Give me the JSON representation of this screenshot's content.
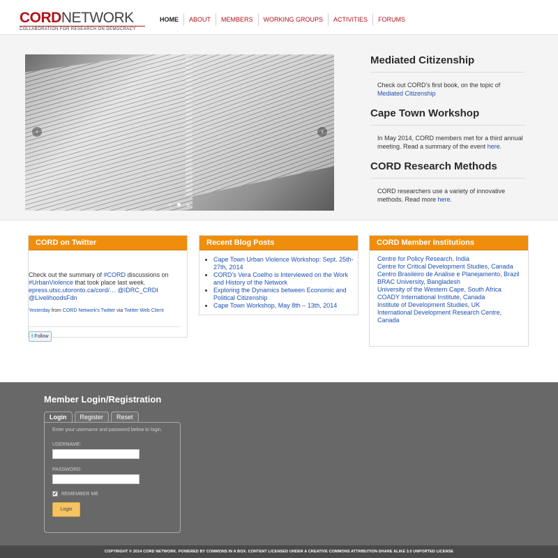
{
  "header": {
    "logo_brand_cord": "CORD",
    "logo_brand_network": "NETWORK",
    "logo_tagline": "COLLABORATION FOR RESEARCH ON DEMOCRACY",
    "nav": [
      "HOME",
      "ABOUT",
      "MEMBERS",
      "WORKING GROUPS",
      "ACTIVITIES",
      "FORUMS"
    ]
  },
  "hero": {
    "prev_arrow": "‹",
    "next_arrow": "›",
    "slide_count": 3,
    "active_slide": 2,
    "features": [
      {
        "title": "Mediated Citizenship",
        "text": "Check out CORD's first book, on the topic of ",
        "link": "Mediated Citizenship"
      },
      {
        "title": "Cape Town Workshop",
        "text": "In May 2014, CORD members met for a third annual meeting. Read a summary of the event ",
        "link": "here."
      },
      {
        "title": "CORD Research Methods",
        "text": "CORD researchers use a variety of innovative methods. Read more ",
        "link": "here."
      }
    ]
  },
  "twitter": {
    "title": "CORD on Twitter",
    "tweet_pre": "Check out the summary of ",
    "tweet_hash1": "#CORD",
    "tweet_mid": " discussions on ",
    "tweet_hash2": "#UrbanViolence",
    "tweet_mid2": " that took place last week. ",
    "tweet_url": "epress.utsc.utoronto.ca/cord/…",
    "tweet_sp": " ",
    "tweet_user1": "@IDRC_CRDI",
    "tweet_user2": "@LivelihoodsFdn",
    "meta_time": "Yesterday",
    "meta_from": " from ",
    "meta_account": "CORD Network's Twitter",
    "meta_via": " via ",
    "meta_client": "Twitter Web Client",
    "follow_label": "Follow"
  },
  "blog": {
    "title": "Recent Blog Posts",
    "posts": [
      "Cape Town Urban Violence Workshop: Sept. 25th-27th, 2014",
      "CORD's Vera Coelho is Interviewed on the Work and History of the Network",
      "Exploring the Dynamics between Economic and Political Citizenship",
      "Cape Town Workshop, May 8th – 13th, 2014"
    ]
  },
  "members": {
    "title": "CORD Member Institutions",
    "items": [
      "Centre for Policy Research, India",
      "Centre for Critical Development Studies, Canada",
      "Centro Brasileiro de Análise e Planejamento, Brazil",
      "BRAC University, Bangladesh",
      "University of the Western Cape, South Africa",
      "COADY International Institute, Canada",
      "Institute of Development Studies, UK",
      "International Development Research Centre, Canada"
    ]
  },
  "login": {
    "title": "Member Login/Registration",
    "tabs": [
      "Login",
      "Register",
      "Reset"
    ],
    "intro": "Enter your username and password below to login.",
    "username_label": "USERNAME:",
    "password_label": "PASSWORD:",
    "remember_label": "REMEMBER ME",
    "remember_checked": true,
    "check_mark": "✔",
    "button_label": "Login"
  },
  "footer": {
    "text": "COPYRIGHT © 2014 CORD NETWORK. POWERED BY COMMONS IN A BOX. CONTENT LICENSED UNDER A CREATIVE COMMONS ATTRIBUTION-SHARE ALIKE 3.0 UNPORTED LICENSE"
  },
  "colors": {
    "brand_red": "#b0121b",
    "box_header_orange": "#ef8e0d",
    "login_bg": "#686868",
    "footer_bg": "#4a4a4a",
    "link_blue": "#1a4fb0"
  }
}
